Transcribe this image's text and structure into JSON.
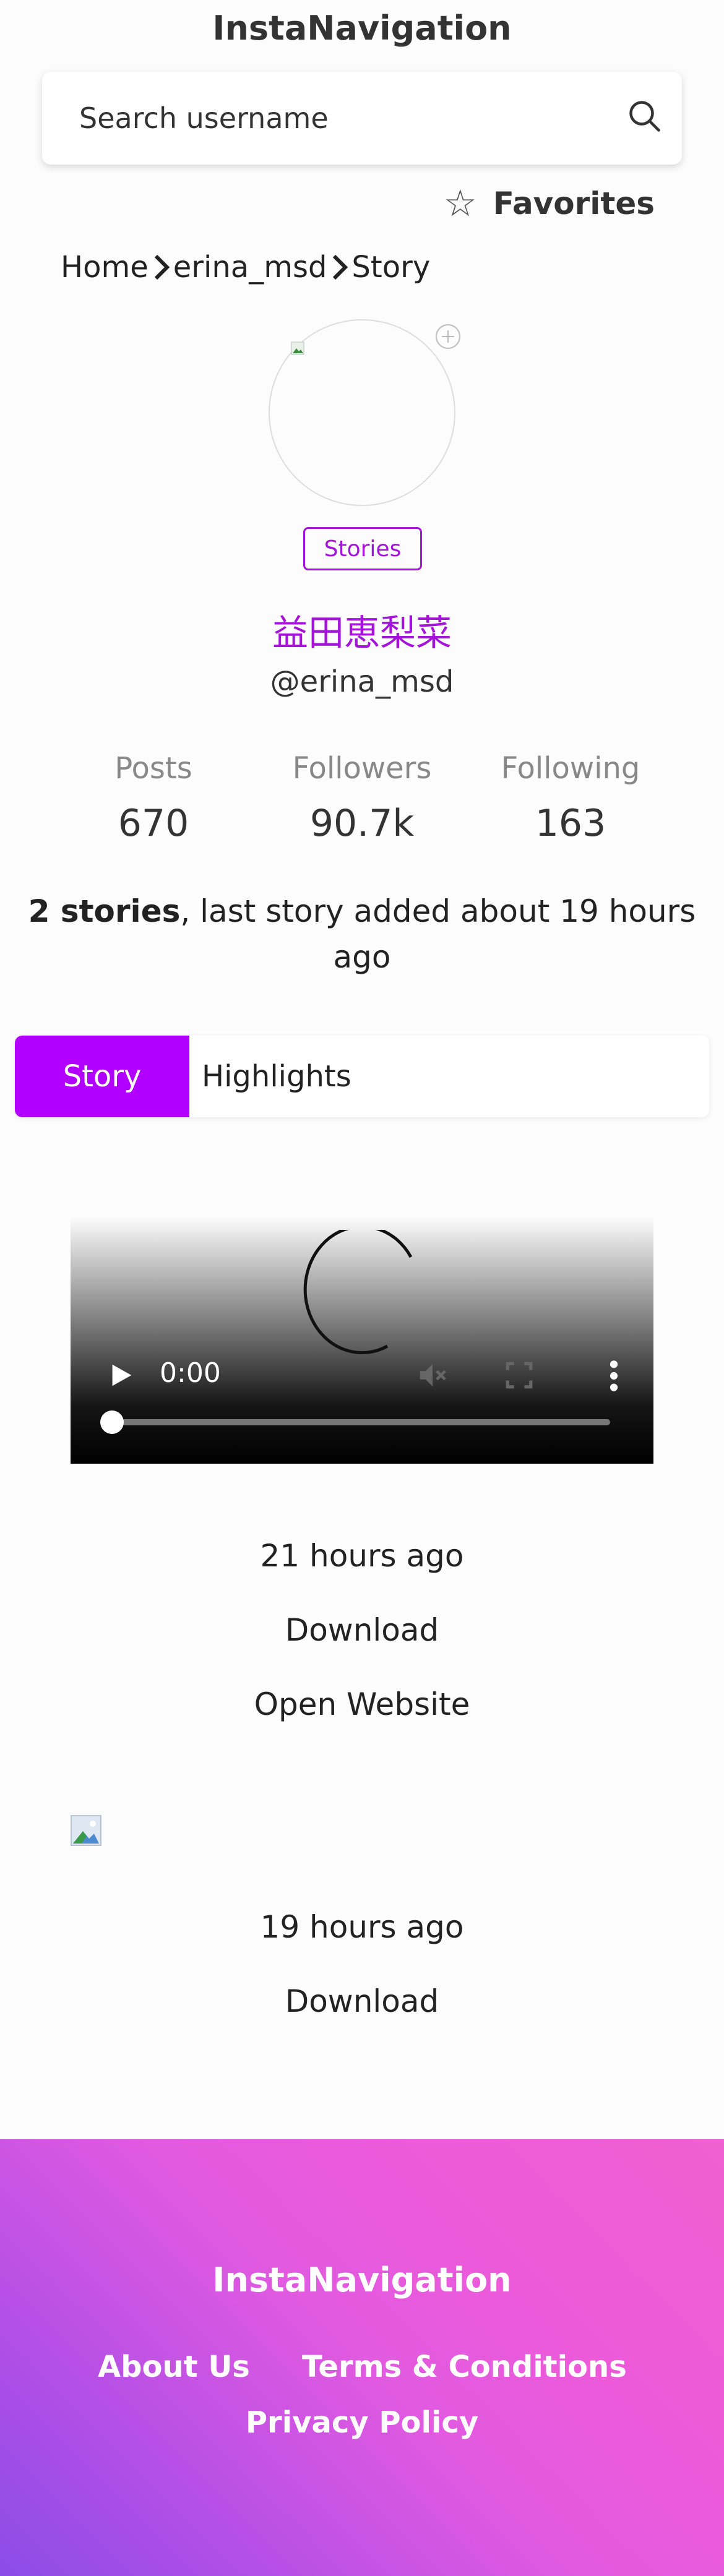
{
  "header": {
    "title": "InstaNavigation"
  },
  "search": {
    "placeholder": "Search username"
  },
  "favorites": {
    "label": "Favorites"
  },
  "breadcrumb": {
    "items": [
      "Home",
      "erina_msd",
      "Story"
    ]
  },
  "profile": {
    "badge": "Stories",
    "display_name": "益田恵梨菜",
    "username": "@erina_msd",
    "stats": [
      {
        "label": "Posts",
        "value": "670"
      },
      {
        "label": "Followers",
        "value": "90.7k"
      },
      {
        "label": "Following",
        "value": "163"
      }
    ],
    "summary_bold": "2 stories",
    "summary_rest": ", last story added about 19 hours ago"
  },
  "tabs": [
    {
      "label": "Story",
      "active": true
    },
    {
      "label": "Highlights",
      "active": false
    }
  ],
  "stories": [
    {
      "type": "video",
      "time_display": "0:00",
      "ago": "21 hours ago",
      "download": "Download",
      "open": "Open Website"
    },
    {
      "type": "image",
      "ago": "19 hours ago",
      "download": "Download"
    }
  ],
  "footer": {
    "brand": "InstaNavigation",
    "links": [
      "About Us",
      "Terms & Conditions",
      "Privacy Policy"
    ]
  },
  "colors": {
    "accent": "#b100ff",
    "name": "#a414d8"
  }
}
